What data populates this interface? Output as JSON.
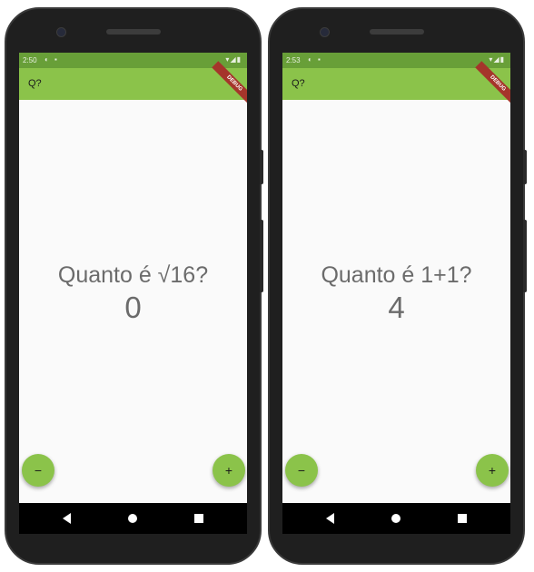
{
  "phones": [
    {
      "status_time": "2:50",
      "app_title": "Q?",
      "debug_label": "DEBUG",
      "question": "Quanto é √16?",
      "answer": "0",
      "fab_minus": "−",
      "fab_plus": "+"
    },
    {
      "status_time": "2:53",
      "app_title": "Q?",
      "debug_label": "DEBUG",
      "question": "Quanto é 1+1?",
      "answer": "4",
      "fab_minus": "−",
      "fab_plus": "+"
    }
  ],
  "colors": {
    "status_bar": "#689f38",
    "app_bar": "#8bc34a",
    "fab": "#8bc34a",
    "text": "#6b6b6b"
  }
}
